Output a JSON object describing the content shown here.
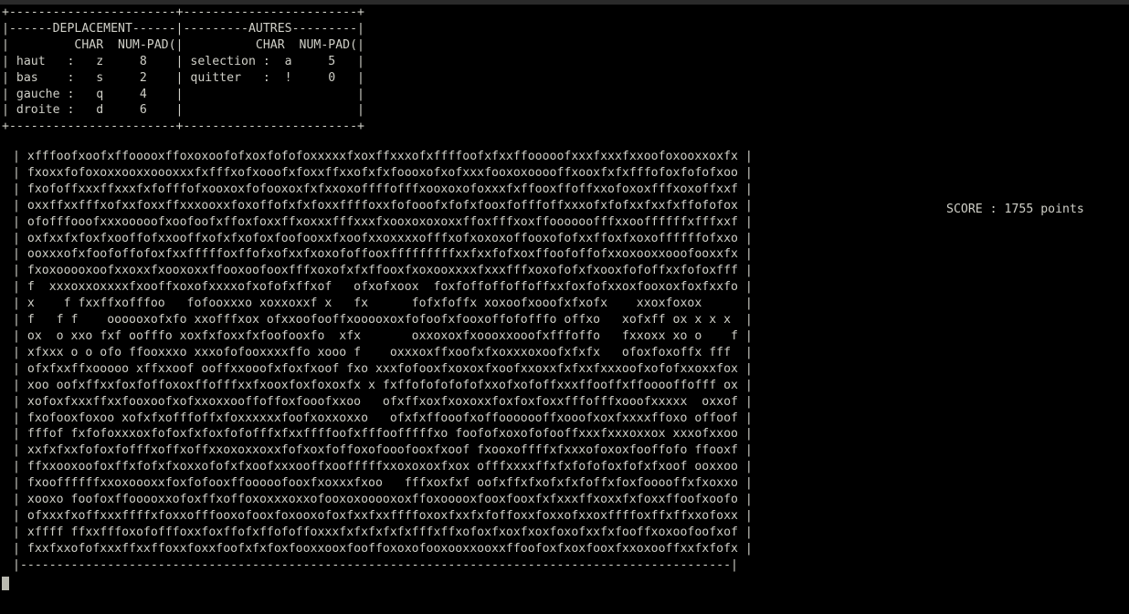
{
  "window": {
    "background_color": "#000000",
    "foreground_color": "#cfcfc7",
    "titlebar_color": "#2a2a2a"
  },
  "help_panel": {
    "sections": [
      {
        "title": "DEPLACEMENT",
        "columns": [
          "CHAR",
          "NUM-PAD(x)"
        ],
        "rows": [
          {
            "action": "haut",
            "separator": ":",
            "char": "z",
            "numpad": "8"
          },
          {
            "action": "bas",
            "separator": ":",
            "char": "s",
            "numpad": "2"
          },
          {
            "action": "gauche",
            "separator": ":",
            "char": "q",
            "numpad": "4"
          },
          {
            "action": "droite",
            "separator": ":",
            "char": "d",
            "numpad": "6"
          }
        ]
      },
      {
        "title": "AUTRES",
        "columns": [
          "CHAR",
          "NUM-PAD(x)"
        ],
        "rows": [
          {
            "action": "selection",
            "separator": ":",
            "char": "a",
            "numpad": "5"
          },
          {
            "action": "quitter",
            "separator": ":",
            "char": "!",
            "numpad": "0"
          }
        ]
      }
    ],
    "ascii": "+-----------------------+------------------------+\n|-------DEPLACEMENT-----|-----------AUTRES-------|\n|         CHAR  NUM-PAD(x)|        CHAR  NUM-PAD(x)|\n| haut  :   z     8     | selection :  a     5   |\n| bas   :   s     2     | quitter   :  !     0   |\n| gauche:   q     4     |                        |\n| droite:   d     6     |                        |\n+-----------------------+------------------------+"
  },
  "score": {
    "label": "SCORE",
    "separator": ":",
    "value": "1755",
    "unit": "points",
    "text": "SCORE : 1755 points"
  },
  "board": {
    "border_char": "|",
    "bottom_rule": "-",
    "rows": [
      "xfffoofxoofxffooooxffoxoxoofofxoxfofofoxxxxxfxoxffxxxofxffffoofxfxxffooooofxxxfxxxfxxoofoxooxxoxfxxf",
      "fxoxxfofoxoxxooxxoooxxxfxfffxofxooofxfoxxffxxofxfxfoooxofxofxxxfooxoxooooffxooxfxfxfffofoxfofofxooffx",
      "fxofoffxxxffxxxfxfofffofxooxoxfofooxoxfxfxxoxoffffofffxooxoxofoxxxfxffooxffoffxxofoxoxfffxoxoffxxfox",
      "oxxffxxfffxofxxfoxxffxxxooxxfoxoffofxfxfoxxffffoxxfofooofxfofxfooxfofffoffxxxofxfofxxfxxfxffofofoxoxxx",
      "ofofffooofxxxooooofxoofoofxffoxfoxxffxoxxxfffxxxfxooxoxoxoxxffoxfffxoxffoooooofffxxooffffffxfffxxfxxxxof",
      "oxfxxfxfoxfxooffofxxooffxofxfxofoxfoofooxxfxoofxxoxxxxofffxofxoxoxoffooxofofxxffoxfxoxoffffffofxxoxxoox",
      "ooxxxofxfoofoffofoxfxxfffffoxffofxofxxfxoxofoffooxfffffffffxxfxxfofxoxffoofoffofxxoxooxxooofooxxfxoofo",
      "fxoxooooxoofxxoxxfxooxoxxffooxoofooxfffxoxofxfxffooxfxoxooxxxxfxxxfffxoxofofxfxooxfofoffxxfofoxfffxoo",
      "f  xxxoxxoxxxxfxooffxoxofxxxxofxofofxffxof   ofxofxoox  foxfoffoffoffoffxxfoxfofxxoxfooxoxfoxfxxfof  xofofx",
      "x    f fxxffxofffoo   fofooxxxo xoxxoxxf x   fx      fofxfoffx xoxoofxooofxfxofx    xxoxfoxox     x  xfxxfof",
      "f   f f    oooooxofxfo xxofffxox ofxxoofooffxooooxoxfofoofxfooxoffofofffo offxo   xofxff ox x x x xxxfo",
      "ox  o xxo fxf oofffo xoxfxfoxxfxfoofooxfo  xfx       oxxoxoxfxoooxxooofxfffoffo   fxxoxx xo o    f oofox",
      "xfxxx o o ofo ffooxxxo xxxofofooxxxxffo xooo f    oxxxoxffxoofxfxoxxxoxoofxfxfx   ofoxfoxoffx fff ffoxx",
      "ofxfxxffxooooo xffxxoof ooffxxooofxfoxfxoof fxo xxxfofooxfxoxoxfxoofxxoxxfxfxxfxxxoofxofofxxoxxfoxoff",
      "xoo oofxffxxfoxfoffoxoxffofffxxfxooxfoxfoxoxfx x fxffofofofofofxxofxofoffxxxffooffxffooooffofff oxxoffx",
      "xofoxfxxxffxxfooxoofxofxxoxxooffoffoxfooofxxoo   ofxffxoxfxoxoxxfoxfoxfoxxfffofffxooofxxxxx  oxxofoxxoox",
      "fxofooxfoxoo xofxfxofffoffxfoxxxxxxfoofxoxxoxxo   ofxfxffooofxoffooooooffxooofxoxfxxxxffoxo offoofoofxo",
      "fffof fxfofoxxxoxfofoxfxfoxfofofffxfxxffffoofxfffoofffffxo foofofxoxofofooffxxxfxxxoxxox xxxofxxoofx",
      "xxfxfxxfofoxfofffxoffxoffxxoxoxxoxxfofxoxfoffoxofooofooxfxoof fxooxoffffxfxxxofoxoxfooffofo ffooxfoffof",
      "ffxxooxoofoxffxfofxfxoxxofofxfxoofxxxooffxoofffffxxoxoxoxfxox offfxxxxffxfxfofofoxfofxfxoof ooxxooxoxfo",
      "fxooffffffxxoxoooxxfoxfofooxffooooofooxfxoxxxfxoo   fffxoxfxf oofxffxfxofxfxfoffxfoxfooooffxfxoxxofxxox",
      "xooxo foofoxffooooxxofoxffxoffoxoxxxoxxofooxoxooooxoxffoxooooxfooxfooxfxfxxxffxoxxfxfoxxffoofxoofofofo",
      "ofxxxfxoffxxxffffxfoxxofffooxofooxfoxooxofoxfxxfxxffffoxoxfxxfxfoffoxxfoxxofxxoxffffoxffxffxxofoxxxfxo",
      "xffff ffxxfffoxofofffoxxfoxffofxffofoffoxxxfxfxfxfxfxfffxffxofoxfxoxfxoxfoxofxxfxfooffxoxoofoofxofofof",
      "fxxfxxofofxxxffxxffoxxfoxxfoofxfxfoxfooxxooxfooffoxoxofooxooxxooxxffoofoxfxoxfooxfxxoxooffxxfxfofxoxoox"
    ],
    "bottom_border": "|--------------------------------------------------------------------------------------------------|"
  },
  "cursor": {
    "visible": true,
    "color": "#b9b9b0"
  }
}
